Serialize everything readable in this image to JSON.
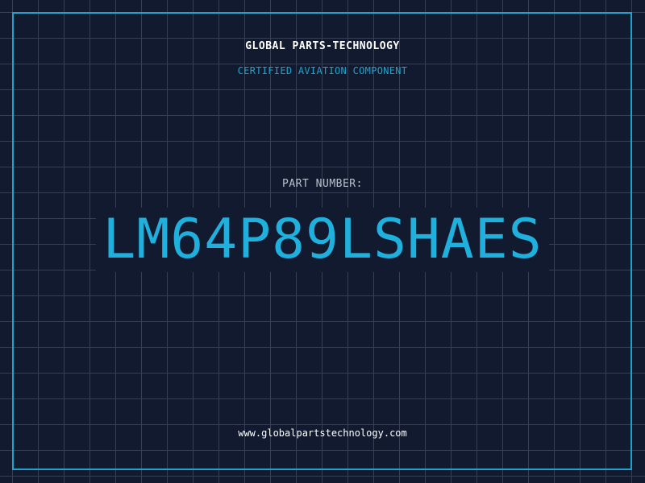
{
  "header": {
    "company": "GLOBAL PARTS-TECHNOLOGY",
    "tagline": "CERTIFIED AVIATION COMPONENT"
  },
  "part": {
    "label": "PART NUMBER:",
    "number": "LM64P89LSHAES"
  },
  "footer": {
    "url": "www.globalpartstechnology.com"
  },
  "colors": {
    "background": "#111a2e",
    "grid": "#1f4a5e",
    "accent": "#1fa3cc",
    "part_number": "#1fb0dd",
    "label": "#b8c2cc",
    "text": "#ffffff"
  }
}
